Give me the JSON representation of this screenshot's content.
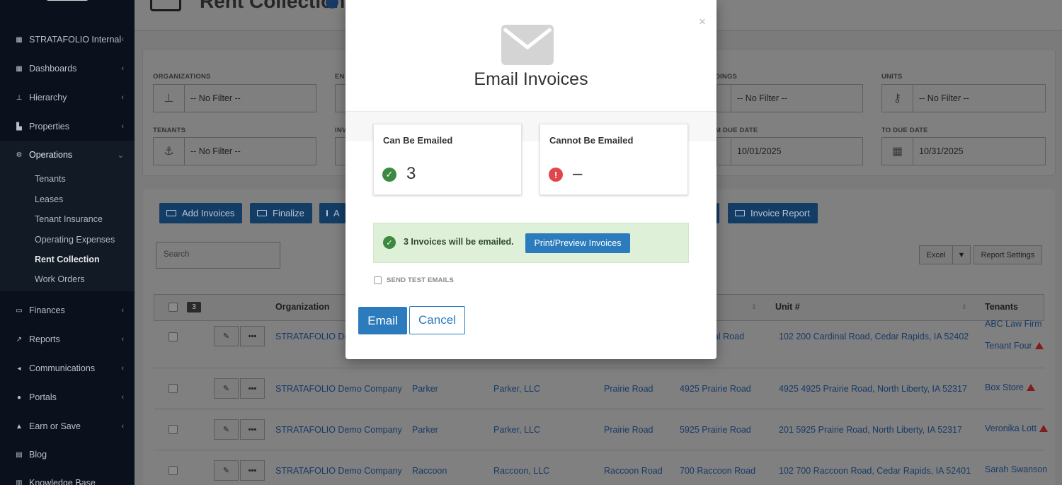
{
  "colors": {
    "accent": "#2b7bbd",
    "success": "#3c8a3f",
    "danger": "#e0474c",
    "alert_bg": "#dff0d8",
    "sidebar_bg": "#0b111c",
    "link": "#173a66"
  },
  "sidebar": {
    "items": [
      {
        "label": "STRATAFOLIO Internal",
        "icon": "grid-icon"
      },
      {
        "label": "Dashboards",
        "icon": "grid-icon"
      },
      {
        "label": "Hierarchy",
        "icon": "sitemap-icon"
      },
      {
        "label": "Properties",
        "icon": "bar-chart-icon"
      },
      {
        "label": "Operations",
        "icon": "gears-icon"
      },
      {
        "label": "Finances",
        "icon": "money-icon"
      },
      {
        "label": "Reports",
        "icon": "line-chart-icon"
      },
      {
        "label": "Communications",
        "icon": "megaphone-icon"
      },
      {
        "label": "Portals",
        "icon": "users-icon"
      },
      {
        "label": "Earn or Save",
        "icon": "thumbs-up-icon"
      },
      {
        "label": "Blog",
        "icon": "blog-icon"
      },
      {
        "label": "Knowledge Base",
        "icon": "book-icon"
      }
    ],
    "operations_sub": [
      "Tenants",
      "Leases",
      "Tenant Insurance",
      "Operating Expenses",
      "Rent Collection",
      "Work Orders"
    ]
  },
  "page": {
    "title": "Rent Collection"
  },
  "filters": {
    "organizations_label": "ORGANIZATIONS",
    "organizations_value": "-- No Filter --",
    "entities_label": "EN",
    "buildings_label": "DINGS",
    "buildings_value": "-- No Filter --",
    "units_label": "UNITS",
    "units_value": "-- No Filter --",
    "tenants_label": "TENANTS",
    "tenants_value": "-- No Filter --",
    "invoices_label": "INV",
    "from_due_label": "M DUE DATE",
    "from_due_value": "10/01/2025",
    "to_due_label": "TO DUE DATE",
    "to_due_value": "10/31/2025"
  },
  "actions": {
    "add_invoices": "Add Invoices",
    "finalize": "Finalize",
    "third": "A",
    "invoice_report": "Invoice Report",
    "search_placeholder": "Search",
    "excel": "Excel",
    "excel_caret": "▼",
    "report_settings": "Report Settings"
  },
  "table": {
    "selected_count": "3",
    "columns": {
      "organization": "Organization",
      "unit": "Unit #",
      "tenants": "Tenants"
    },
    "rows": [
      {
        "org": "STRATAFOLIO Demo",
        "col2": "",
        "col3": "",
        "col4": "",
        "building": "nal Road",
        "unit": "102 200 Cardinal Road, Cedar Rapids, IA 52402",
        "tenant": "ABC Law Firm",
        "tenant2": "Tenant Four"
      },
      {
        "org": "STRATAFOLIO Demo Company",
        "col2": "Parker",
        "col3": "Parker, LLC",
        "col4": "Prairie Road",
        "building": "4925 Prairie Road",
        "unit": "4925 4925 Prairie Road, North Liberty, IA 52317",
        "tenant": "Box Store",
        "tenant2": ""
      },
      {
        "org": "STRATAFOLIO Demo Company",
        "col2": "Parker",
        "col3": "Parker, LLC",
        "col4": "Prairie Road",
        "building": "5925 Prairie Road",
        "unit": "201 5925 Prairie Road, North Liberty, IA 52317",
        "tenant": "Veronika Lott",
        "tenant2": ""
      },
      {
        "org": "STRATAFOLIO Demo Company",
        "col2": "Raccoon",
        "col3": "Raccoon, LLC",
        "col4": "Raccoon Road",
        "building": "700 Raccoon Road",
        "unit": "102 700 Raccoon Road, Cedar Rapids, IA 52401",
        "tenant": "Sarah Swanson",
        "tenant2": ""
      }
    ]
  },
  "modal": {
    "title": "Email Invoices",
    "close": "×",
    "can_be_emailed_label": "Can Be Emailed",
    "can_be_emailed_value": "3",
    "cannot_be_emailed_label": "Cannot Be Emailed",
    "cannot_be_emailed_value": "–",
    "alert_text": "3 Invoices will be emailed.",
    "preview_button": "Print/Preview Invoices",
    "send_test_label": "SEND TEST EMAILS",
    "email_button": "Email",
    "cancel_button": "Cancel"
  }
}
